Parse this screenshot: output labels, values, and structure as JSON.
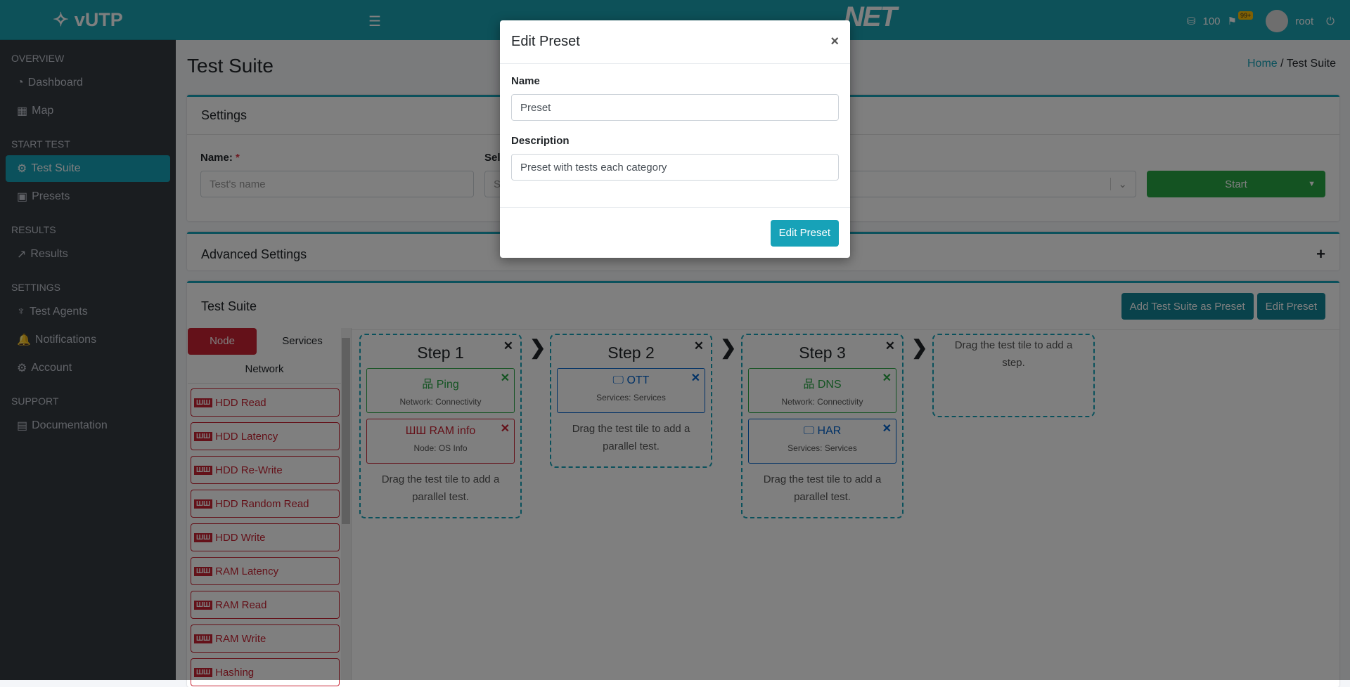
{
  "app": {
    "name": "vUTP",
    "logo": "NET"
  },
  "topbar": {
    "credits": "100",
    "notif_badge": "99+",
    "user": "root"
  },
  "sidebar": {
    "sections": [
      {
        "title": "OVERVIEW",
        "items": [
          {
            "label": "Dashboard",
            "icon": "◔"
          },
          {
            "label": "Map",
            "icon": "▦"
          }
        ]
      },
      {
        "title": "START TEST",
        "items": [
          {
            "label": "Test Suite",
            "icon": "⚙"
          },
          {
            "label": "Presets",
            "icon": "▣"
          }
        ]
      },
      {
        "title": "RESULTS",
        "items": [
          {
            "label": "Results",
            "icon": "↗"
          }
        ]
      },
      {
        "title": "SETTINGS",
        "items": [
          {
            "label": "Test Agents",
            "icon": "♆"
          },
          {
            "label": "Notifications",
            "icon": "🔔"
          },
          {
            "label": "Account",
            "icon": "⚙"
          }
        ]
      },
      {
        "title": "SUPPORT",
        "items": [
          {
            "label": "Documentation",
            "icon": "▤"
          }
        ]
      }
    ]
  },
  "page": {
    "title": "Test Suite",
    "breadcrumb": {
      "home": "Home",
      "current": "Test Suite"
    }
  },
  "settings": {
    "header": "Settings",
    "name_label": "Name:",
    "required": "*",
    "name_placeholder": "Test's name",
    "select_label": "Sel",
    "select_placeholder": "S",
    "start": "Start"
  },
  "advanced": {
    "header": "Advanced Settings",
    "toggle": "+"
  },
  "suite": {
    "header": "Test Suite",
    "add_preset": "Add Test Suite as Preset",
    "edit_preset": "Edit Preset",
    "tabs": [
      "Node",
      "Services",
      "Network"
    ],
    "palette": [
      "HDD Read",
      "HDD Latency",
      "HDD Re-Write",
      "HDD Random Read",
      "HDD Write",
      "RAM Latency",
      "RAM Read",
      "RAM Write",
      "Hashing"
    ],
    "steps": [
      {
        "title": "Step 1",
        "tiles": [
          {
            "name": "Ping",
            "category": "Network: Connectivity",
            "type": "network"
          },
          {
            "name": "RAM info",
            "category": "Node: OS Info",
            "type": "node"
          }
        ]
      },
      {
        "title": "Step 2",
        "tiles": [
          {
            "name": "OTT",
            "category": "Services: Services",
            "type": "services"
          }
        ]
      },
      {
        "title": "Step 3",
        "tiles": [
          {
            "name": "DNS",
            "category": "Network: Connectivity",
            "type": "network"
          },
          {
            "name": "HAR",
            "category": "Services: Services",
            "type": "services"
          }
        ]
      }
    ],
    "hint": "Drag the test tile to add a parallel test.",
    "new_step_hint": "Drag the test tile to add a step."
  },
  "modal": {
    "title": "Edit Preset",
    "close": "×",
    "name_label": "Name",
    "name_value": "Preset",
    "desc_label": "Description",
    "desc_value": "Preset with tests each category",
    "submit": "Edit Preset"
  },
  "colors": {
    "accent": "#17a2b8",
    "node": "#c82333",
    "network": "#28a745",
    "services": "#0062cc",
    "start": "#28a745"
  }
}
